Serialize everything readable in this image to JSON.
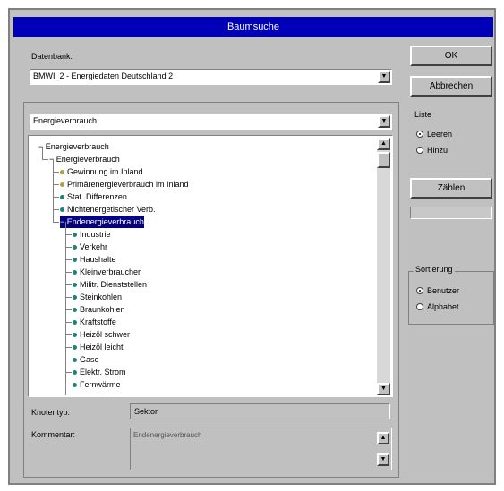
{
  "window": {
    "title": "Baumsuche"
  },
  "database": {
    "label": "Datenbank:",
    "value": "BMWI_2 - Energiedaten Deutschland 2"
  },
  "category": {
    "value": "Energieverbrauch"
  },
  "tree": {
    "items": [
      {
        "label": "Energieverbrauch",
        "level": 0,
        "marker": "minus"
      },
      {
        "label": "Energieverbrauch",
        "level": 1,
        "marker": "minus"
      },
      {
        "label": "Gewinnung im Inland",
        "level": 2,
        "marker": "yellow"
      },
      {
        "label": "Primärenergieverbrauch im Inland",
        "level": 2,
        "marker": "yellow"
      },
      {
        "label": "Stat. Differenzen",
        "level": 2,
        "marker": "teal"
      },
      {
        "label": "Nichtenergetischer Verb.",
        "level": 2,
        "marker": "teal"
      },
      {
        "label": "Endenergieverbrauch",
        "level": 2,
        "marker": "minus",
        "selected": true
      },
      {
        "label": "Industrie",
        "level": 3,
        "marker": "teal"
      },
      {
        "label": "Verkehr",
        "level": 3,
        "marker": "teal"
      },
      {
        "label": "Haushalte",
        "level": 3,
        "marker": "teal"
      },
      {
        "label": "Kleinverbraucher",
        "level": 3,
        "marker": "teal"
      },
      {
        "label": "Militr. Dienststellen",
        "level": 3,
        "marker": "teal"
      },
      {
        "label": "Steinkohlen",
        "level": 3,
        "marker": "teal"
      },
      {
        "label": "Braunkohlen",
        "level": 3,
        "marker": "teal"
      },
      {
        "label": "Kraftstoffe",
        "level": 3,
        "marker": "teal"
      },
      {
        "label": "Heizöl schwer",
        "level": 3,
        "marker": "teal"
      },
      {
        "label": "Heizöl leicht",
        "level": 3,
        "marker": "teal"
      },
      {
        "label": "Gase",
        "level": 3,
        "marker": "teal"
      },
      {
        "label": "Elektr. Strom",
        "level": 3,
        "marker": "teal"
      },
      {
        "label": "Fernwärme",
        "level": 3,
        "marker": "teal"
      }
    ]
  },
  "node_type": {
    "label": "Knotentyp:",
    "value": "Sektor"
  },
  "comment": {
    "label": "Kommentar:",
    "value": "Endenergieverbrauch"
  },
  "buttons": {
    "ok": "OK",
    "cancel": "Abbrechen",
    "count": "Zählen"
  },
  "list": {
    "label": "Liste",
    "options": [
      "Leeren",
      "Hinzu"
    ],
    "selected": 0
  },
  "sort": {
    "label": "Sortierung",
    "options": [
      "Benutzer",
      "Alphabet"
    ],
    "selected": 0
  },
  "colors": {
    "title_bar": "#0000b8",
    "selection": "#000080",
    "dialog": "#c0c0c0",
    "yellow_marker": "#b0a040",
    "teal_marker": "#208080"
  }
}
